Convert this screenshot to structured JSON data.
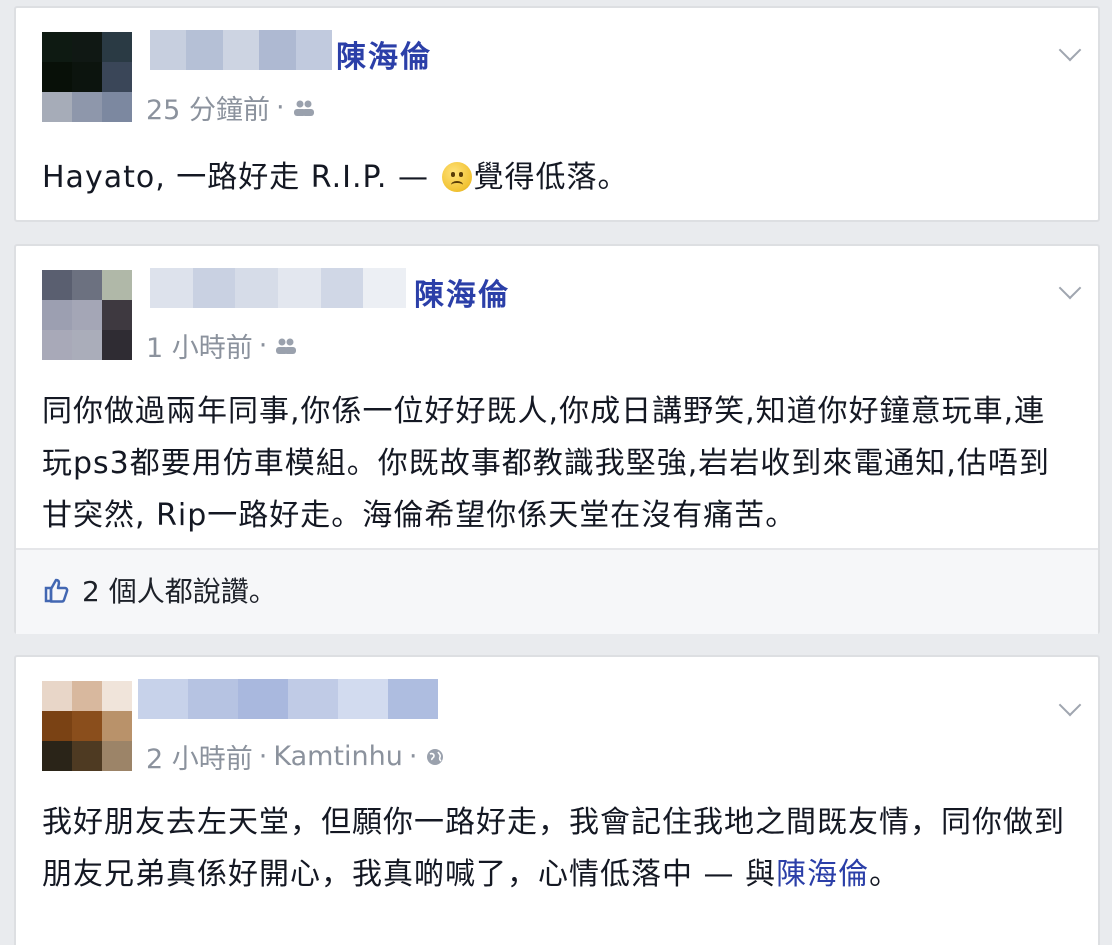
{
  "posts": [
    {
      "tagged_name": "陳海倫",
      "timestamp": "25 分鐘前",
      "audience_icon": "friends-icon",
      "text": "Hayato, 一路好走 R.I.P. — ",
      "feeling_icon": "sad-face-icon",
      "feeling": "覺得低落。"
    },
    {
      "tagged_name": "陳海倫",
      "timestamp": "1 小時前",
      "audience_icon": "friends-icon",
      "text": "同你做過兩年同事,你係一位好好既人,你成日講野笑,知道你好鐘意玩車,連玩ps3都要用仿車模組。你既故事都教識我堅強,岩岩收到來電通知,估唔到甘突然, Rip一路好走。海倫希望你係天堂在沒有痛苦。",
      "likes": "2 個人都說讚。"
    },
    {
      "timestamp": "2 小時前",
      "location": "Kamtinhu",
      "audience_icon": "globe-icon",
      "text": "我好朋友去左天堂，但願你一路好走，我會記住我地之間既友情，同你做到朋友兄弟真係好開心，我真啲喊了，心情低落中 — 與",
      "tagged_link": "陳海倫",
      "tail": "。"
    }
  ],
  "colors": {
    "background": "#e9ebee",
    "card": "#ffffff",
    "link_blue": "#2b3fa8",
    "meta_gray": "#8b929d"
  }
}
